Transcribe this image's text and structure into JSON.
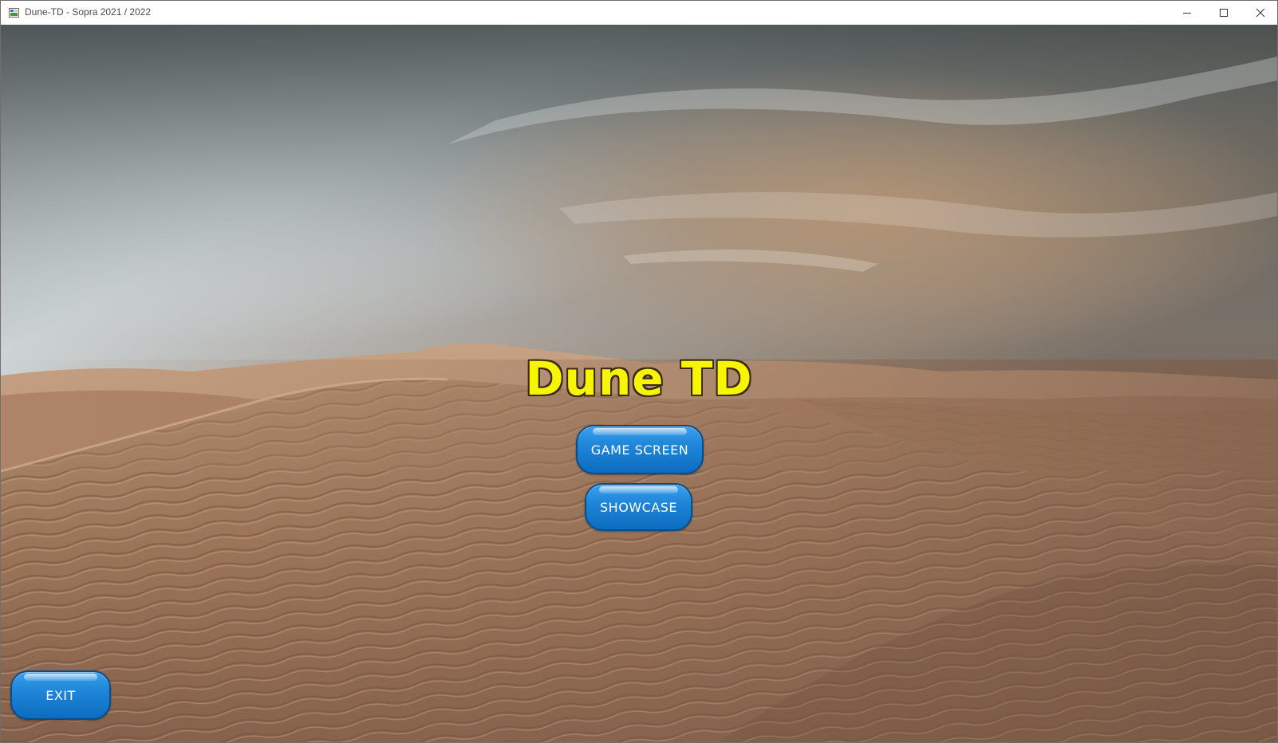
{
  "window": {
    "title": "Dune-TD - Sopra 2021 / 2022",
    "controls": [
      "minimize-icon",
      "maximize-icon",
      "close-icon"
    ]
  },
  "menu": {
    "game_title": "Dune TD",
    "game_screen_label": "GAME SCREEN",
    "showcase_label": "SHOWCASE",
    "exit_label": "EXIT"
  },
  "colors": {
    "title_fill": "#f8f500",
    "title_outline": "#3a2c14",
    "button_blue": "#1f86d8",
    "button_border": "#0a4d86"
  }
}
